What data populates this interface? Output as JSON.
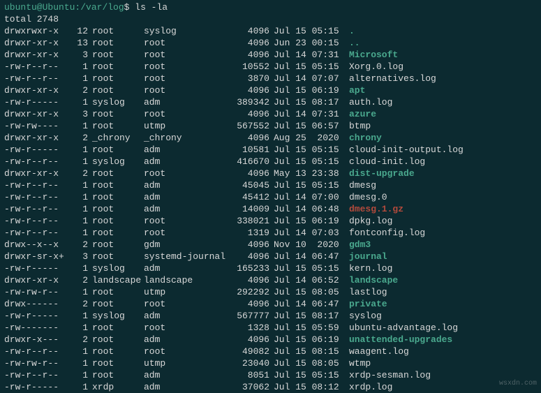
{
  "prompt": {
    "user_host": "ubuntu@Ubuntu",
    "path": "/var/log",
    "symbol": "$",
    "command": "ls -la"
  },
  "total_line": "total 2748",
  "entries": [
    {
      "perms": "drwxrwxr-x",
      "links": "12",
      "owner": "root",
      "group": "syslog",
      "size": "4096",
      "date": "Jul 15 05:15",
      "name": ".",
      "cls": "dir"
    },
    {
      "perms": "drwxr-xr-x",
      "links": "13",
      "owner": "root",
      "group": "root",
      "size": "4096",
      "date": "Jun 23 00:15",
      "name": "..",
      "cls": "dir"
    },
    {
      "perms": "drwxr-xr-x",
      "links": "3",
      "owner": "root",
      "group": "root",
      "size": "4096",
      "date": "Jul 14 07:31",
      "name": "Microsoft",
      "cls": "dir"
    },
    {
      "perms": "-rw-r--r--",
      "links": "1",
      "owner": "root",
      "group": "root",
      "size": "10552",
      "date": "Jul 15 05:15",
      "name": "Xorg.0.log",
      "cls": ""
    },
    {
      "perms": "-rw-r--r--",
      "links": "1",
      "owner": "root",
      "group": "root",
      "size": "3870",
      "date": "Jul 14 07:07",
      "name": "alternatives.log",
      "cls": ""
    },
    {
      "perms": "drwxr-xr-x",
      "links": "2",
      "owner": "root",
      "group": "root",
      "size": "4096",
      "date": "Jul 15 06:19",
      "name": "apt",
      "cls": "dir"
    },
    {
      "perms": "-rw-r-----",
      "links": "1",
      "owner": "syslog",
      "group": "adm",
      "size": "389342",
      "date": "Jul 15 08:17",
      "name": "auth.log",
      "cls": ""
    },
    {
      "perms": "drwxr-xr-x",
      "links": "3",
      "owner": "root",
      "group": "root",
      "size": "4096",
      "date": "Jul 14 07:31",
      "name": "azure",
      "cls": "dir"
    },
    {
      "perms": "-rw-rw----",
      "links": "1",
      "owner": "root",
      "group": "utmp",
      "size": "567552",
      "date": "Jul 15 06:57",
      "name": "btmp",
      "cls": ""
    },
    {
      "perms": "drwxr-xr-x",
      "links": "2",
      "owner": "_chrony",
      "group": "_chrony",
      "size": "4096",
      "date": "Aug 25  2020",
      "name": "chrony",
      "cls": "dir"
    },
    {
      "perms": "-rw-r-----",
      "links": "1",
      "owner": "root",
      "group": "adm",
      "size": "10581",
      "date": "Jul 15 05:15",
      "name": "cloud-init-output.log",
      "cls": ""
    },
    {
      "perms": "-rw-r--r--",
      "links": "1",
      "owner": "syslog",
      "group": "adm",
      "size": "416670",
      "date": "Jul 15 05:15",
      "name": "cloud-init.log",
      "cls": ""
    },
    {
      "perms": "drwxr-xr-x",
      "links": "2",
      "owner": "root",
      "group": "root",
      "size": "4096",
      "date": "May 13 23:38",
      "name": "dist-upgrade",
      "cls": "dir"
    },
    {
      "perms": "-rw-r--r--",
      "links": "1",
      "owner": "root",
      "group": "adm",
      "size": "45045",
      "date": "Jul 15 05:15",
      "name": "dmesg",
      "cls": ""
    },
    {
      "perms": "-rw-r--r--",
      "links": "1",
      "owner": "root",
      "group": "adm",
      "size": "45412",
      "date": "Jul 14 07:00",
      "name": "dmesg.0",
      "cls": ""
    },
    {
      "perms": "-rw-r--r--",
      "links": "1",
      "owner": "root",
      "group": "adm",
      "size": "14009",
      "date": "Jul 14 06:48",
      "name": "dmesg.1.gz",
      "cls": "link-archive"
    },
    {
      "perms": "-rw-r--r--",
      "links": "1",
      "owner": "root",
      "group": "root",
      "size": "338021",
      "date": "Jul 15 06:19",
      "name": "dpkg.log",
      "cls": ""
    },
    {
      "perms": "-rw-r--r--",
      "links": "1",
      "owner": "root",
      "group": "root",
      "size": "1319",
      "date": "Jul 14 07:03",
      "name": "fontconfig.log",
      "cls": ""
    },
    {
      "perms": "drwx--x--x",
      "links": "2",
      "owner": "root",
      "group": "gdm",
      "size": "4096",
      "date": "Nov 10  2020",
      "name": "gdm3",
      "cls": "dir"
    },
    {
      "perms": "drwxr-sr-x+",
      "links": "3",
      "owner": "root",
      "group": "systemd-journal",
      "size": "4096",
      "date": "Jul 14 06:47",
      "name": "journal",
      "cls": "dir"
    },
    {
      "perms": "-rw-r-----",
      "links": "1",
      "owner": "syslog",
      "group": "adm",
      "size": "165233",
      "date": "Jul 15 05:15",
      "name": "kern.log",
      "cls": ""
    },
    {
      "perms": "drwxr-xr-x",
      "links": "2",
      "owner": "landscape",
      "group": "landscape",
      "size": "4096",
      "date": "Jul 14 06:52",
      "name": "landscape",
      "cls": "dir"
    },
    {
      "perms": "-rw-rw-r--",
      "links": "1",
      "owner": "root",
      "group": "utmp",
      "size": "292292",
      "date": "Jul 15 08:05",
      "name": "lastlog",
      "cls": ""
    },
    {
      "perms": "drwx------",
      "links": "2",
      "owner": "root",
      "group": "root",
      "size": "4096",
      "date": "Jul 14 06:47",
      "name": "private",
      "cls": "dir"
    },
    {
      "perms": "-rw-r-----",
      "links": "1",
      "owner": "syslog",
      "group": "adm",
      "size": "567777",
      "date": "Jul 15 08:17",
      "name": "syslog",
      "cls": ""
    },
    {
      "perms": "-rw-------",
      "links": "1",
      "owner": "root",
      "group": "root",
      "size": "1328",
      "date": "Jul 15 05:59",
      "name": "ubuntu-advantage.log",
      "cls": ""
    },
    {
      "perms": "drwxr-x---",
      "links": "2",
      "owner": "root",
      "group": "adm",
      "size": "4096",
      "date": "Jul 15 06:19",
      "name": "unattended-upgrades",
      "cls": "dir"
    },
    {
      "perms": "-rw-r--r--",
      "links": "1",
      "owner": "root",
      "group": "root",
      "size": "49082",
      "date": "Jul 15 08:15",
      "name": "waagent.log",
      "cls": ""
    },
    {
      "perms": "-rw-rw-r--",
      "links": "1",
      "owner": "root",
      "group": "utmp",
      "size": "23040",
      "date": "Jul 15 08:05",
      "name": "wtmp",
      "cls": ""
    },
    {
      "perms": "-rw-r--r--",
      "links": "1",
      "owner": "root",
      "group": "adm",
      "size": "8051",
      "date": "Jul 15 05:15",
      "name": "xrdp-sesman.log",
      "cls": ""
    },
    {
      "perms": "-rw-r-----",
      "links": "1",
      "owner": "xrdp",
      "group": "adm",
      "size": "37062",
      "date": "Jul 15 08:12",
      "name": "xrdp.log",
      "cls": ""
    }
  ],
  "watermark": "wsxdn.com"
}
